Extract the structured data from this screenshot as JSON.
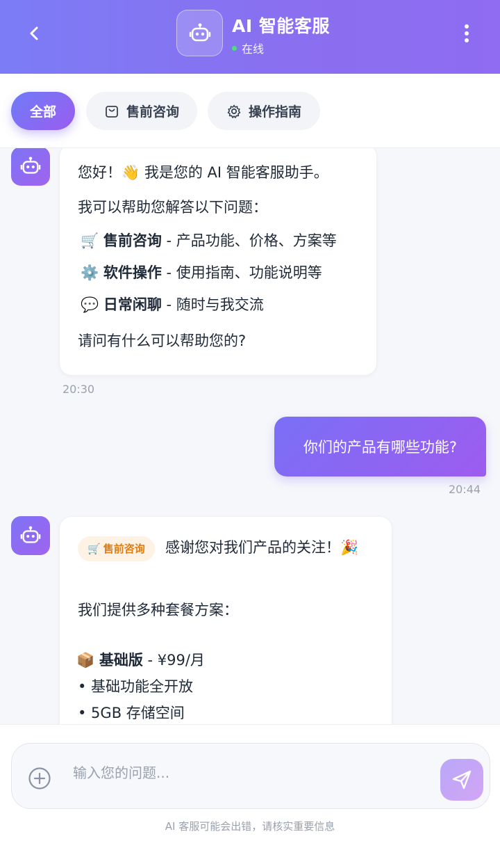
{
  "header": {
    "title": "AI 智能客服",
    "status": "在线",
    "accent_color": "#8a6ff0",
    "status_color": "#4ade80"
  },
  "tabs": [
    {
      "label": "全部",
      "icon": "none",
      "active": true
    },
    {
      "label": "售前咨询",
      "icon": "shopping-bag-icon",
      "active": false
    },
    {
      "label": "操作指南",
      "icon": "gear-icon",
      "active": false
    }
  ],
  "messages": {
    "bot1": {
      "greeting": "您好！👋 我是您的 AI 智能客服助手。",
      "intro": "我可以帮助您解答以下问题：",
      "items": [
        {
          "emoji": "🛒",
          "title": "售前咨询",
          "desc": " - 产品功能、价格、方案等"
        },
        {
          "emoji": "⚙️",
          "title": "软件操作",
          "desc": " - 使用指南、功能说明等"
        },
        {
          "emoji": "💬",
          "title": "日常闲聊",
          "desc": " - 随时与我交流"
        }
      ],
      "closing": "请问有什么可以帮助您的?",
      "time": "20:30"
    },
    "user1": {
      "text": "你们的产品有哪些功能?",
      "time": "20:44"
    },
    "bot2": {
      "badge_emoji": "🛒",
      "badge": "售前咨询",
      "thanks": "感谢您对我们产品的关注！🎉",
      "plans_intro": "我们提供多种套餐方案：",
      "plan_emoji": "📦",
      "plan_name": "基础版",
      "plan_price": " - ¥99/月",
      "features": [
        "• 基础功能全开放",
        "• 5GB 存储空间"
      ]
    }
  },
  "input": {
    "placeholder": "输入您的问题...",
    "value": ""
  },
  "disclaimer": "AI 客服可能会出错，请核实重要信息"
}
